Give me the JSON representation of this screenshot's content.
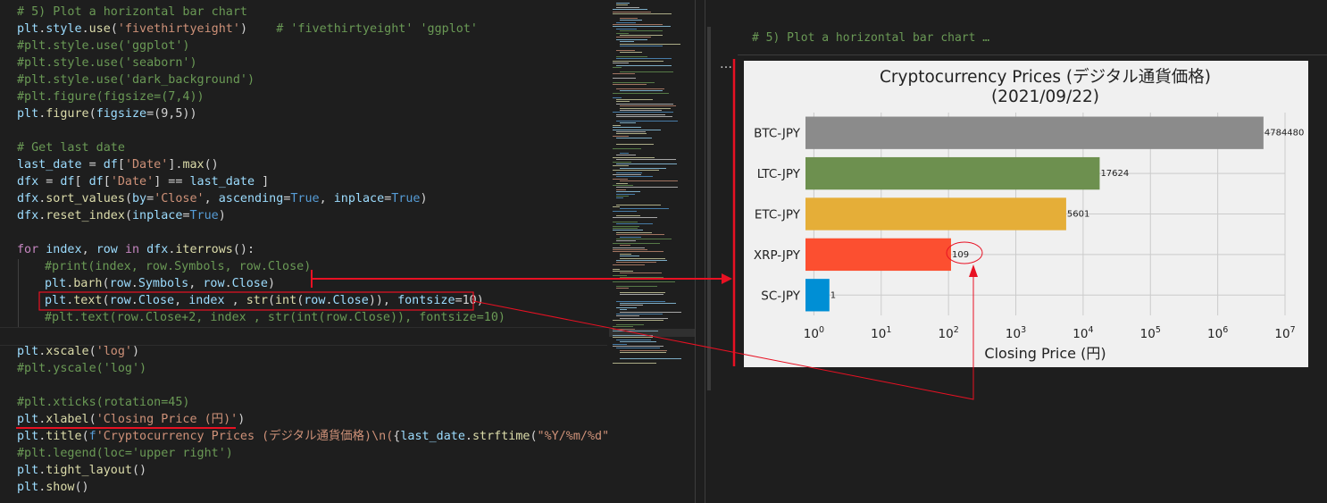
{
  "editor": {
    "lines": [
      [
        [
          "tok-com",
          "# 5) Plot a horizontal bar chart"
        ]
      ],
      [
        [
          "tok-var",
          "plt"
        ],
        [
          "tok-op",
          "."
        ],
        [
          "tok-var",
          "style"
        ],
        [
          "tok-op",
          "."
        ],
        [
          "tok-fn",
          "use"
        ],
        [
          "tok-op",
          "("
        ],
        [
          "tok-str",
          "'fivethirtyeight'"
        ],
        [
          "tok-op",
          ")    "
        ],
        [
          "tok-com",
          "# 'fivethirtyeight' 'ggplot'"
        ]
      ],
      [
        [
          "tok-com",
          "#plt.style.use('ggplot')"
        ]
      ],
      [
        [
          "tok-com",
          "#plt.style.use('seaborn')"
        ]
      ],
      [
        [
          "tok-com",
          "#plt.style.use('dark_background')"
        ]
      ],
      [
        [
          "tok-com",
          "#plt.figure(figsize=(7,4))"
        ]
      ],
      [
        [
          "tok-var",
          "plt"
        ],
        [
          "tok-op",
          "."
        ],
        [
          "tok-fn",
          "figure"
        ],
        [
          "tok-op",
          "("
        ],
        [
          "tok-var",
          "figsize"
        ],
        [
          "tok-op",
          "=(9,5))"
        ]
      ],
      [],
      [
        [
          "tok-com",
          "# Get last date"
        ]
      ],
      [
        [
          "tok-var",
          "last_date"
        ],
        [
          "tok-op",
          " = "
        ],
        [
          "tok-var",
          "df"
        ],
        [
          "tok-op",
          "["
        ],
        [
          "tok-str",
          "'Date'"
        ],
        [
          "tok-op",
          "]."
        ],
        [
          "tok-fn",
          "max"
        ],
        [
          "tok-op",
          "()"
        ]
      ],
      [
        [
          "tok-var",
          "dfx"
        ],
        [
          "tok-op",
          " = "
        ],
        [
          "tok-var",
          "df"
        ],
        [
          "tok-op",
          "[ "
        ],
        [
          "tok-var",
          "df"
        ],
        [
          "tok-op",
          "["
        ],
        [
          "tok-str",
          "'Date'"
        ],
        [
          "tok-op",
          "] == "
        ],
        [
          "tok-var",
          "last_date"
        ],
        [
          "tok-op",
          " ]"
        ]
      ],
      [
        [
          "tok-var",
          "dfx"
        ],
        [
          "tok-op",
          "."
        ],
        [
          "tok-fn",
          "sort_values"
        ],
        [
          "tok-op",
          "("
        ],
        [
          "tok-var",
          "by"
        ],
        [
          "tok-op",
          "="
        ],
        [
          "tok-str",
          "'Close'"
        ],
        [
          "tok-op",
          ", "
        ],
        [
          "tok-var",
          "ascending"
        ],
        [
          "tok-op",
          "="
        ],
        [
          "tok-kw",
          "True"
        ],
        [
          "tok-op",
          ", "
        ],
        [
          "tok-var",
          "inplace"
        ],
        [
          "tok-op",
          "="
        ],
        [
          "tok-kw",
          "True"
        ],
        [
          "tok-op",
          ")"
        ]
      ],
      [
        [
          "tok-var",
          "dfx"
        ],
        [
          "tok-op",
          "."
        ],
        [
          "tok-fn",
          "reset_index"
        ],
        [
          "tok-op",
          "("
        ],
        [
          "tok-var",
          "inplace"
        ],
        [
          "tok-op",
          "="
        ],
        [
          "tok-kw",
          "True"
        ],
        [
          "tok-op",
          ")"
        ]
      ],
      [],
      [
        [
          "tok-key",
          "for"
        ],
        [
          "tok-op",
          " "
        ],
        [
          "tok-var",
          "index"
        ],
        [
          "tok-op",
          ", "
        ],
        [
          "tok-var",
          "row"
        ],
        [
          "tok-op",
          " "
        ],
        [
          "tok-key",
          "in"
        ],
        [
          "tok-op",
          " "
        ],
        [
          "tok-var",
          "dfx"
        ],
        [
          "tok-op",
          "."
        ],
        [
          "tok-fn",
          "iterrows"
        ],
        [
          "tok-op",
          "():"
        ]
      ],
      [
        [
          "tok-com",
          "#print(index, row.Symbols, row.Close)"
        ]
      ],
      [
        [
          "tok-var",
          "plt"
        ],
        [
          "tok-op",
          "."
        ],
        [
          "tok-fn",
          "barh"
        ],
        [
          "tok-op",
          "("
        ],
        [
          "tok-var",
          "row"
        ],
        [
          "tok-op",
          "."
        ],
        [
          "tok-var",
          "Symbols"
        ],
        [
          "tok-op",
          ", "
        ],
        [
          "tok-var",
          "row"
        ],
        [
          "tok-op",
          "."
        ],
        [
          "tok-var",
          "Close"
        ],
        [
          "tok-op",
          ")"
        ]
      ],
      [
        [
          "tok-var",
          "plt"
        ],
        [
          "tok-op",
          "."
        ],
        [
          "tok-fn",
          "text"
        ],
        [
          "tok-op",
          "("
        ],
        [
          "tok-var",
          "row"
        ],
        [
          "tok-op",
          "."
        ],
        [
          "tok-var",
          "Close"
        ],
        [
          "tok-op",
          ", "
        ],
        [
          "tok-var",
          "index"
        ],
        [
          "tok-op",
          " , "
        ],
        [
          "tok-fn",
          "str"
        ],
        [
          "tok-op",
          "("
        ],
        [
          "tok-fn",
          "int"
        ],
        [
          "tok-op",
          "("
        ],
        [
          "tok-var",
          "row"
        ],
        [
          "tok-op",
          "."
        ],
        [
          "tok-var",
          "Close"
        ],
        [
          "tok-op",
          ")), "
        ],
        [
          "tok-var",
          "fontsize"
        ],
        [
          "tok-op",
          "=10)"
        ]
      ],
      [
        [
          "tok-com",
          "#plt.text(row.Close+2, index , str(int(row.Close)), fontsize=10)"
        ]
      ],
      [],
      [
        [
          "tok-var",
          "plt"
        ],
        [
          "tok-op",
          "."
        ],
        [
          "tok-fn",
          "xscale"
        ],
        [
          "tok-op",
          "("
        ],
        [
          "tok-str",
          "'log'"
        ],
        [
          "tok-op",
          ")"
        ]
      ],
      [
        [
          "tok-com",
          "#plt.yscale('log')"
        ]
      ],
      [],
      [
        [
          "tok-com",
          "#plt.xticks(rotation=45)"
        ]
      ],
      [
        [
          "tok-var",
          "plt"
        ],
        [
          "tok-op",
          "."
        ],
        [
          "tok-fn",
          "xlabel"
        ],
        [
          "tok-op",
          "("
        ],
        [
          "tok-str",
          "'Closing Price (円)'"
        ],
        [
          "tok-op",
          ")"
        ]
      ],
      [
        [
          "tok-var",
          "plt"
        ],
        [
          "tok-op",
          "."
        ],
        [
          "tok-fn",
          "title"
        ],
        [
          "tok-op",
          "("
        ],
        [
          "tok-kw",
          "f"
        ],
        [
          "tok-str",
          "'Cryptocurrency Prices (デジタル通貨価格)\\n("
        ],
        [
          "tok-op",
          "{"
        ],
        [
          "tok-var",
          "last_date"
        ],
        [
          "tok-op",
          "."
        ],
        [
          "tok-fn",
          "strftime"
        ],
        [
          "tok-op",
          "("
        ],
        [
          "tok-str",
          "\"%Y/%m/%d\""
        ],
        [
          "tok-op",
          ")}"
        ]
      ],
      [
        [
          "tok-com",
          "#plt.legend(loc='upper right')"
        ]
      ],
      [
        [
          "tok-var",
          "plt"
        ],
        [
          "tok-op",
          "."
        ],
        [
          "tok-fn",
          "tight_layout"
        ],
        [
          "tok-op",
          "()"
        ]
      ],
      [
        [
          "tok-var",
          "plt"
        ],
        [
          "tok-op",
          "."
        ],
        [
          "tok-fn",
          "show"
        ],
        [
          "tok-op",
          "()"
        ]
      ]
    ],
    "indented_lines": [
      15,
      16,
      17,
      18
    ]
  },
  "output": {
    "cell_header": "# 5) Plot a horizontal bar chart …",
    "more_label": "…"
  },
  "chart_data": {
    "type": "bar",
    "orientation": "horizontal",
    "title": "Cryptocurrency Prices (デジタル通貨価格)\n(2021/09/22)",
    "xlabel": "Closing Price (円)",
    "ylabel": "",
    "xscale": "log",
    "xlim": [
      0.75,
      10000000
    ],
    "xticks": [
      {
        "value": 1,
        "base": "10",
        "exp": "0"
      },
      {
        "value": 10,
        "base": "10",
        "exp": "1"
      },
      {
        "value": 100,
        "base": "10",
        "exp": "2"
      },
      {
        "value": 1000,
        "base": "10",
        "exp": "3"
      },
      {
        "value": 10000,
        "base": "10",
        "exp": "4"
      },
      {
        "value": 100000,
        "base": "10",
        "exp": "5"
      },
      {
        "value": 1000000,
        "base": "10",
        "exp": "6"
      },
      {
        "value": 10000000,
        "base": "10",
        "exp": "7"
      }
    ],
    "grid": true,
    "categories": [
      "BTC-JPY",
      "LTC-JPY",
      "ETC-JPY",
      "XRP-JPY",
      "SC-JPY"
    ],
    "values": [
      4784480,
      17624,
      5601,
      109,
      1.7
    ],
    "value_labels": [
      "4784480",
      "17624",
      "5601",
      "109",
      "1"
    ],
    "colors": [
      "#8b8b8b",
      "#6d904f",
      "#e5ae38",
      "#fc4f30",
      "#008fd5"
    ]
  },
  "colors": {
    "annotation": "#e81123",
    "plot_bg": "#f0f0f0",
    "editor_bg": "#1e1e1e"
  }
}
